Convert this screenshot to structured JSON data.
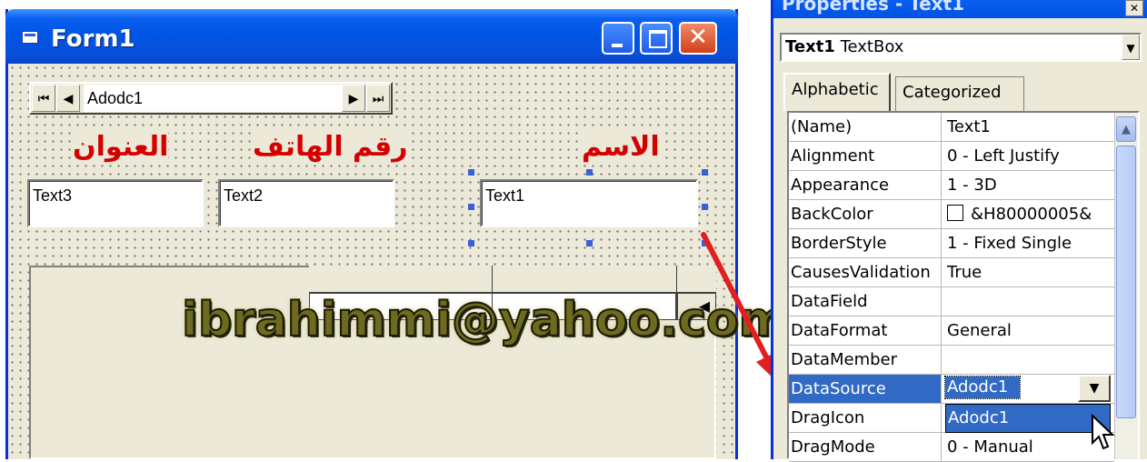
{
  "form": {
    "title": "Form1",
    "adodc_caption": "Adodc1",
    "nav": {
      "first": "⏮",
      "prev": "◀",
      "next": "▶",
      "last": "⏭"
    },
    "labels": {
      "address": "العنوان",
      "phone": "رقم الهاتف",
      "name": "الاسم"
    },
    "textboxes": {
      "text3": "Text3",
      "text2": "Text2",
      "text1": "Text1"
    },
    "grid_row_indicator": "◀",
    "close_glyph": "✕"
  },
  "watermark": "ibrahimmi@yahoo.com",
  "properties": {
    "title": "Properties - Text1",
    "object_name": "Text1",
    "object_type": "TextBox",
    "tabs": {
      "alphabetic": "Alphabetic",
      "categorized": "Categorized"
    },
    "rows": [
      {
        "name": "(Name)",
        "value": "Text1"
      },
      {
        "name": "Alignment",
        "value": "0 - Left Justify"
      },
      {
        "name": "Appearance",
        "value": "1 - 3D"
      },
      {
        "name": "BackColor",
        "value": "&H80000005&"
      },
      {
        "name": "BorderStyle",
        "value": "1 - Fixed Single"
      },
      {
        "name": "CausesValidation",
        "value": "True"
      },
      {
        "name": "DataField",
        "value": ""
      },
      {
        "name": "DataFormat",
        "value": "General"
      },
      {
        "name": "DataMember",
        "value": ""
      },
      {
        "name": "DataSource",
        "value": "Adodc1"
      },
      {
        "name": "DragIcon",
        "value": ""
      },
      {
        "name": "DragMode",
        "value": "0 - Manual"
      }
    ],
    "selected_row": "DataSource",
    "datasource_value": "Adodc1",
    "datasource_option": "Adodc1"
  },
  "colors": {
    "title_blue": "#0054e3",
    "label_red": "#d40000",
    "selection": "#316ac5",
    "arrow": "#e02020"
  }
}
